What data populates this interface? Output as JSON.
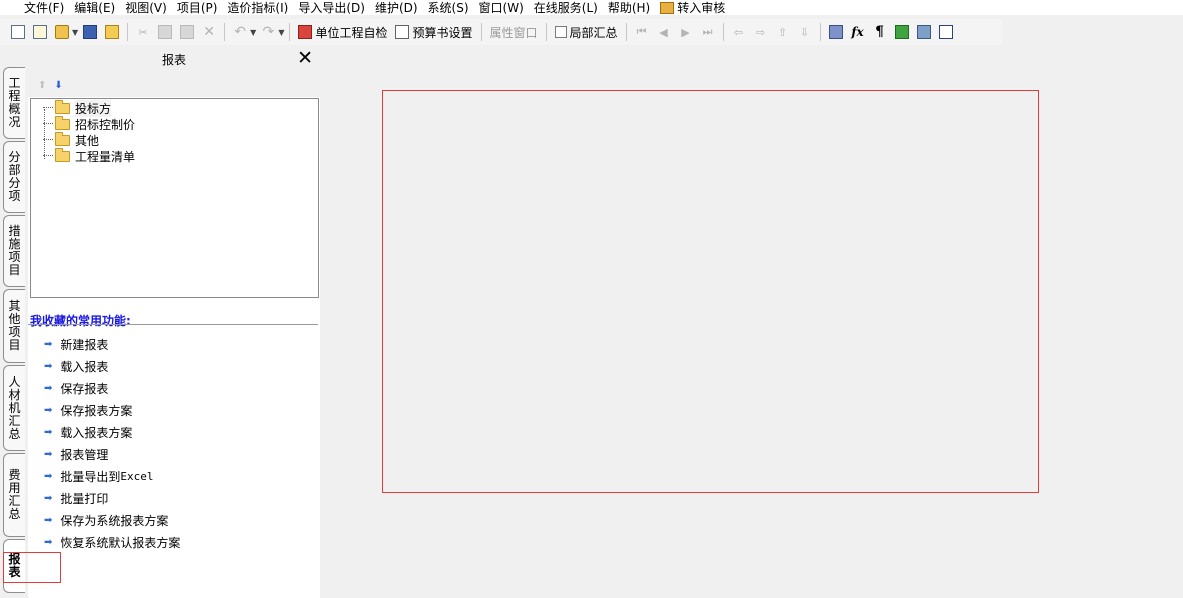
{
  "menu": [
    "文件(F)",
    "编辑(E)",
    "视图(V)",
    "项目(P)",
    "造价指标(I)",
    "导入导出(D)",
    "维护(D)",
    "系统(S)",
    "窗口(W)",
    "在线服务(L)",
    "帮助(H)"
  ],
  "menu_audit": "转入审核",
  "toolbar": {
    "self_check": "单位工程自检",
    "budget_setting": "预算书设置",
    "property_window": "属性窗口",
    "local_summary": "局部汇总"
  },
  "tabs": [
    "工程概况",
    "分部分项",
    "措施项目",
    "其他项目",
    "人材机汇总",
    "费用汇总",
    "报表"
  ],
  "panel": {
    "title": "报表",
    "close": "✕",
    "tree": [
      "投标方",
      "招标控制价",
      "其他",
      "工程量清单"
    ],
    "favorites_title": "我收藏的常用功能:",
    "favorites": [
      "新建报表",
      "载入报表",
      "保存报表",
      "保存报表方案",
      "载入报表方案",
      "报表管理",
      "批量导出到",
      "批量打印",
      "保存为系统报表方案",
      "恢复系统默认报表方案"
    ],
    "excel_word": "Excel"
  },
  "icons": {
    "new": "new-document-icon",
    "open": "open-folder-icon",
    "save": "save-disk-icon",
    "cut": "cut-icon",
    "copy": "copy-icon",
    "paste": "paste-icon",
    "delete": "delete-icon",
    "undo": "undo-icon",
    "redo": "redo-icon",
    "first": "first-record-icon",
    "prev": "previous-record-icon",
    "next": "next-record-icon",
    "last": "last-record-icon",
    "calculator": "calculator-icon",
    "formula": "formula-icon",
    "paragraph": "paragraph-icon",
    "cube": "cube-icon",
    "report": "report-image-icon",
    "list": "list-icon"
  },
  "colors": {
    "accent_blue": "#1a1ae0",
    "arrow_blue": "#2c6ad8",
    "highlight_red": "#e23b3b"
  }
}
